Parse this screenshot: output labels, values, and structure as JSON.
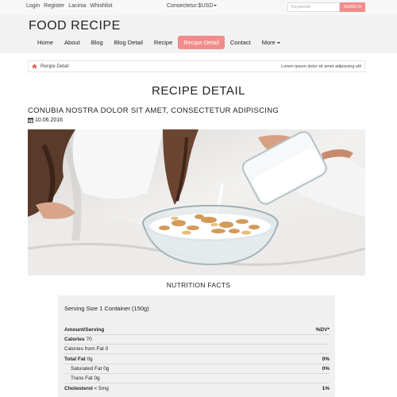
{
  "topbar": {
    "links": [
      "Login",
      "Register",
      "Lacinia",
      "Whishlist"
    ],
    "currency": "Consectetur:$USD",
    "search_placeholder": "Keywords",
    "search_button": "SEARCH"
  },
  "header": {
    "brand": "FOOD RECIPE",
    "nav": [
      "Home",
      "About",
      "Blog",
      "Blog Detail",
      "Recipe",
      "Recipe Detail",
      "Contact",
      "More"
    ],
    "active_nav": "Recipe Detail"
  },
  "breadcrumb": {
    "current": "Recipe Detail",
    "right_text": "Lorem ipsum dolor sit amet adipiscing elit"
  },
  "page_title": "RECIPE DETAIL",
  "post": {
    "title": "CONUBIA NOSTRA DOLOR SIT AMET, CONSECTETUR ADIPISCING",
    "date": "10.06.2016"
  },
  "nutrition": {
    "heading": "NUTRITION FACTS",
    "serving": "Serving Size 1 Container (150g)",
    "header_left": "Amount/Serving",
    "header_right": "%DV*",
    "calories_label": "Calories",
    "calories_value": "70",
    "calories_fat": "Calories from Fat 0",
    "total_fat_label": "Total Fat",
    "total_fat_value": "0g",
    "total_fat_dv": "0%",
    "sat_fat": "Saturated Fat 0g",
    "sat_fat_dv": "0%",
    "trans_fat": "Trans Fat 0g",
    "cholesterol_label": "Cholesterol",
    "cholesterol_value": "< 5mg",
    "cholesterol_dv": "1%"
  },
  "colors": {
    "accent": "#f28b8b",
    "header_bg": "#f2f2f2",
    "nutrition_bg": "#f0f0f0"
  }
}
